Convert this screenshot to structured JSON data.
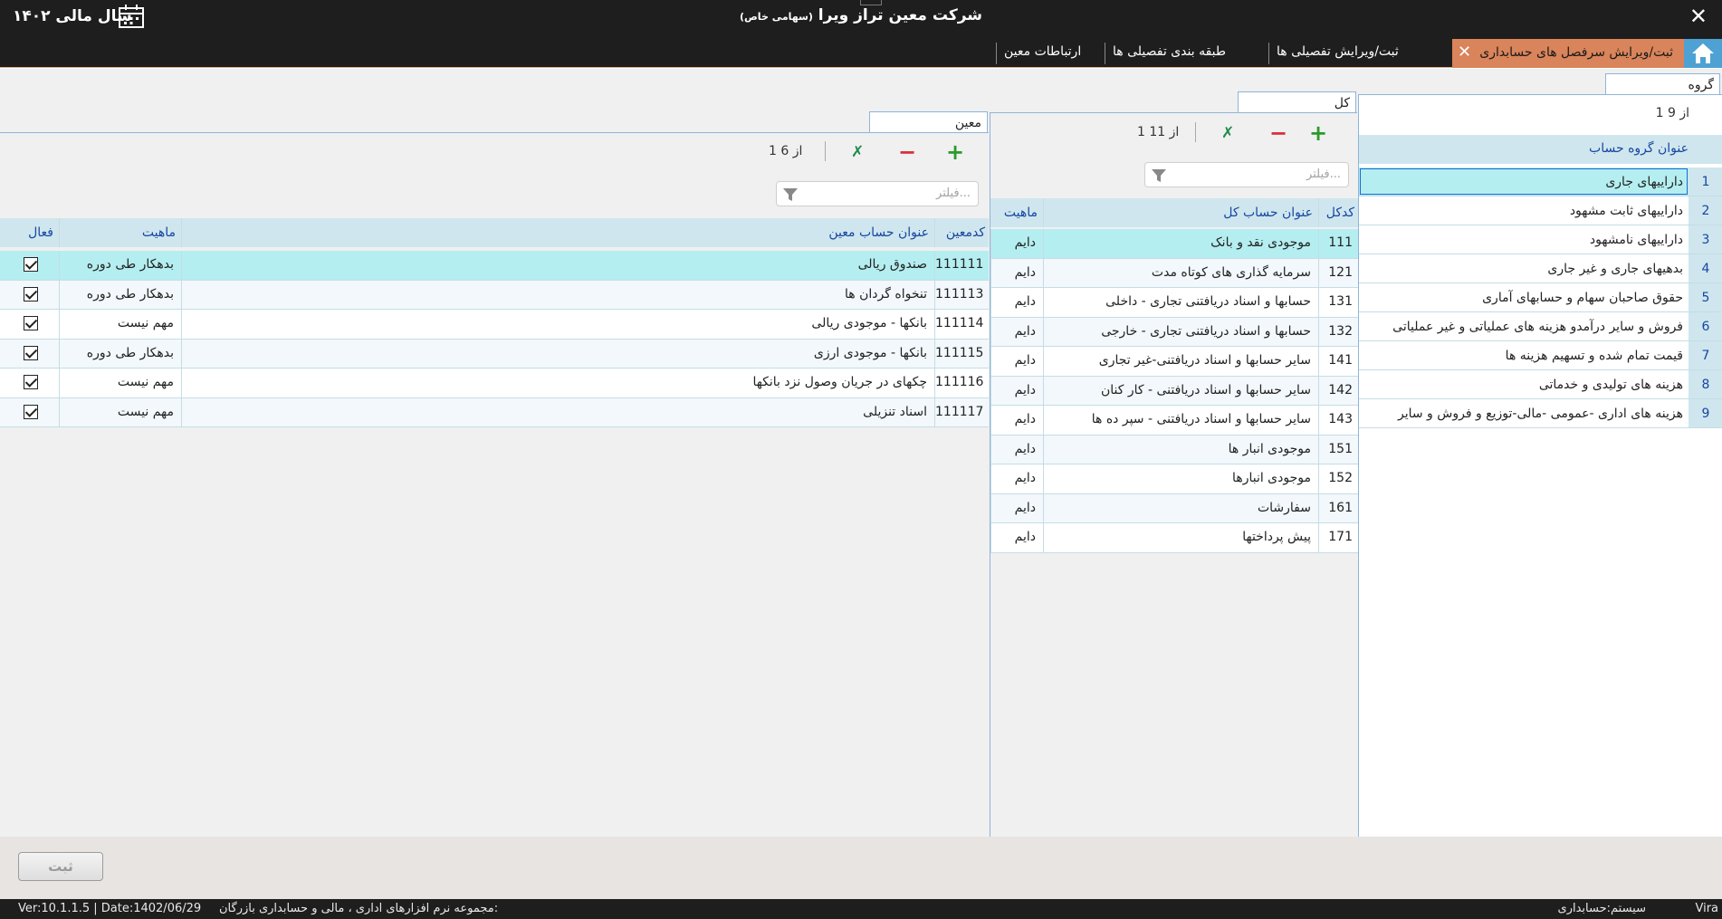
{
  "window": {
    "title": "شرکت معین تراز ویرا",
    "title_suffix": "(سهامی خاص)",
    "fiscal_year": "سال مالی ۱۴۰۲"
  },
  "tabs": {
    "active": "ثبت/ویرایش  سرفصل های حسابداری",
    "items": [
      "ثبت/ویرایش تفصیلی ها",
      "طبقه بندی تفصیلی ها",
      "ارتباطات معین"
    ]
  },
  "group": {
    "tab_label": "گروه",
    "pager": "1  از  9",
    "header_title": "عنوان گروه حساب",
    "rows": [
      {
        "num": "1",
        "title": "داراییهای جاری"
      },
      {
        "num": "2",
        "title": "داراییهای ثابت مشهود"
      },
      {
        "num": "3",
        "title": "داراییهای نامشهود"
      },
      {
        "num": "4",
        "title": "بدهیهای جاری و غیر جاری"
      },
      {
        "num": "5",
        "title": "حقوق صاحبان سهام و حسابهای آماری"
      },
      {
        "num": "6",
        "title": "فروش و سایر درآمدو هزینه های عملیاتی و غیر عملیاتی"
      },
      {
        "num": "7",
        "title": "قیمت تمام شده و تسهیم هزینه ها"
      },
      {
        "num": "8",
        "title": "هزینه های تولیدی و خدماتی"
      },
      {
        "num": "9",
        "title": "هزینه های اداری -عمومی -مالی-توزیع و فروش و سایر"
      }
    ]
  },
  "kol": {
    "tab_label": "کل",
    "pager": "1  از  11",
    "filter_placeholder": "فیلتر...",
    "headers": {
      "code": "کدکل",
      "title": "عنوان حساب کل",
      "nature": "ماهیت"
    },
    "rows": [
      {
        "code": "111",
        "title": "موجودی نقد و بانک",
        "nature": "دایم"
      },
      {
        "code": "121",
        "title": "سرمایه گذاری های کوتاه مدت",
        "nature": "دایم"
      },
      {
        "code": "131",
        "title": "حسابها و اسناد دریافتنی تجاری - داخلی",
        "nature": "دایم"
      },
      {
        "code": "132",
        "title": "حسابها و اسناد دریافتنی تجاری - خارجی",
        "nature": "دایم"
      },
      {
        "code": "141",
        "title": "سایر حسابها و اسناد دریافتنی-غیر تجاری",
        "nature": "دایم"
      },
      {
        "code": "142",
        "title": "سایر حسابها و اسناد دریافتنی - کار کنان",
        "nature": "دایم"
      },
      {
        "code": "143",
        "title": "سایر حسابها و اسناد دریافتنی - سپر ده ها",
        "nature": "دایم"
      },
      {
        "code": "151",
        "title": "موجودی انبار ها",
        "nature": "دایم"
      },
      {
        "code": "152",
        "title": "موجودی انبارها",
        "nature": "دایم"
      },
      {
        "code": "161",
        "title": "سفارشات",
        "nature": "دایم"
      },
      {
        "code": "171",
        "title": "پیش پرداختها",
        "nature": "دایم"
      }
    ]
  },
  "moein": {
    "tab_label": "معین",
    "pager": "1  از  6",
    "filter_placeholder": "فیلتر...",
    "headers": {
      "code": "کدمعین",
      "title": "عنوان حساب معین",
      "nature": "ماهیت",
      "active": "فعال"
    },
    "rows": [
      {
        "code": "111111",
        "title": "صندوق ریالی",
        "nature": "بدهکار طی دوره",
        "active": true
      },
      {
        "code": "111113",
        "title": "تنخواه گردان ها",
        "nature": "بدهکار طی دوره",
        "active": true
      },
      {
        "code": "111114",
        "title": "بانکها - موجودی ریالی",
        "nature": "مهم نیست",
        "active": true
      },
      {
        "code": "111115",
        "title": "بانکها - موجودی ارزی",
        "nature": "بدهکار طی دوره",
        "active": true
      },
      {
        "code": "111116",
        "title": "چکهای در جریان وصول نزد بانکها",
        "nature": "مهم نیست",
        "active": true
      },
      {
        "code": "111117",
        "title": "اسناد تنزیلی",
        "nature": "مهم نیست",
        "active": true
      }
    ]
  },
  "save_button": "ثبت",
  "status": {
    "brand": "Vira",
    "system": "سیستم:حسابداری",
    "suite": "مجموعه نرم افزارهای اداری ، مالی و حسابداری بازرگان:",
    "version": "Ver:10.1.1.5 | Date:1402/06/29"
  },
  "colors": {
    "accent_tab": "#d9845a",
    "home": "#4ea1d3",
    "header": "#cfe6ee",
    "selected_row": "#b4eef0",
    "chrome": "#1e1e1e"
  }
}
